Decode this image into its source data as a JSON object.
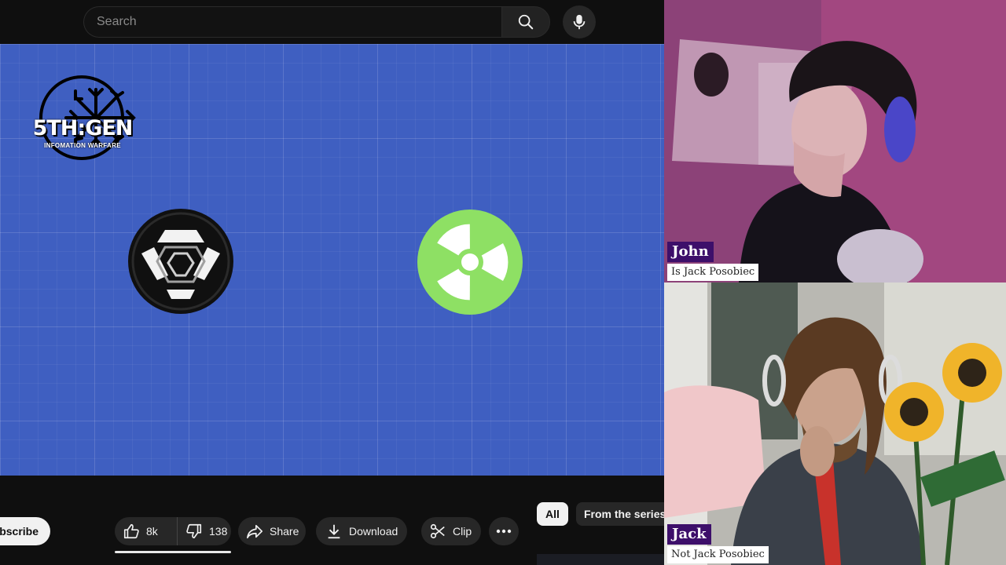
{
  "youtube": {
    "search": {
      "placeholder": "Search"
    },
    "video": {
      "logo_text": "5TH:GEN",
      "logo_subtext": "INFOMATION WARFARE"
    },
    "actions": {
      "subscribe_label": "ubscribe",
      "like_count": "8k",
      "dislike_count": "138",
      "share_label": "Share",
      "download_label": "Download",
      "clip_label": "Clip"
    },
    "chips": {
      "all_label": "All",
      "series_label": "From the series"
    }
  },
  "participants": [
    {
      "name": "John",
      "subtitle": "Is Jack Posobiec"
    },
    {
      "name": "Jack",
      "subtitle": "Not Jack Posobiec"
    }
  ],
  "colors": {
    "video_bg": "#3f5fc1",
    "radiation_green": "#8ee064",
    "nametag_purple": "#3d0f6a"
  }
}
